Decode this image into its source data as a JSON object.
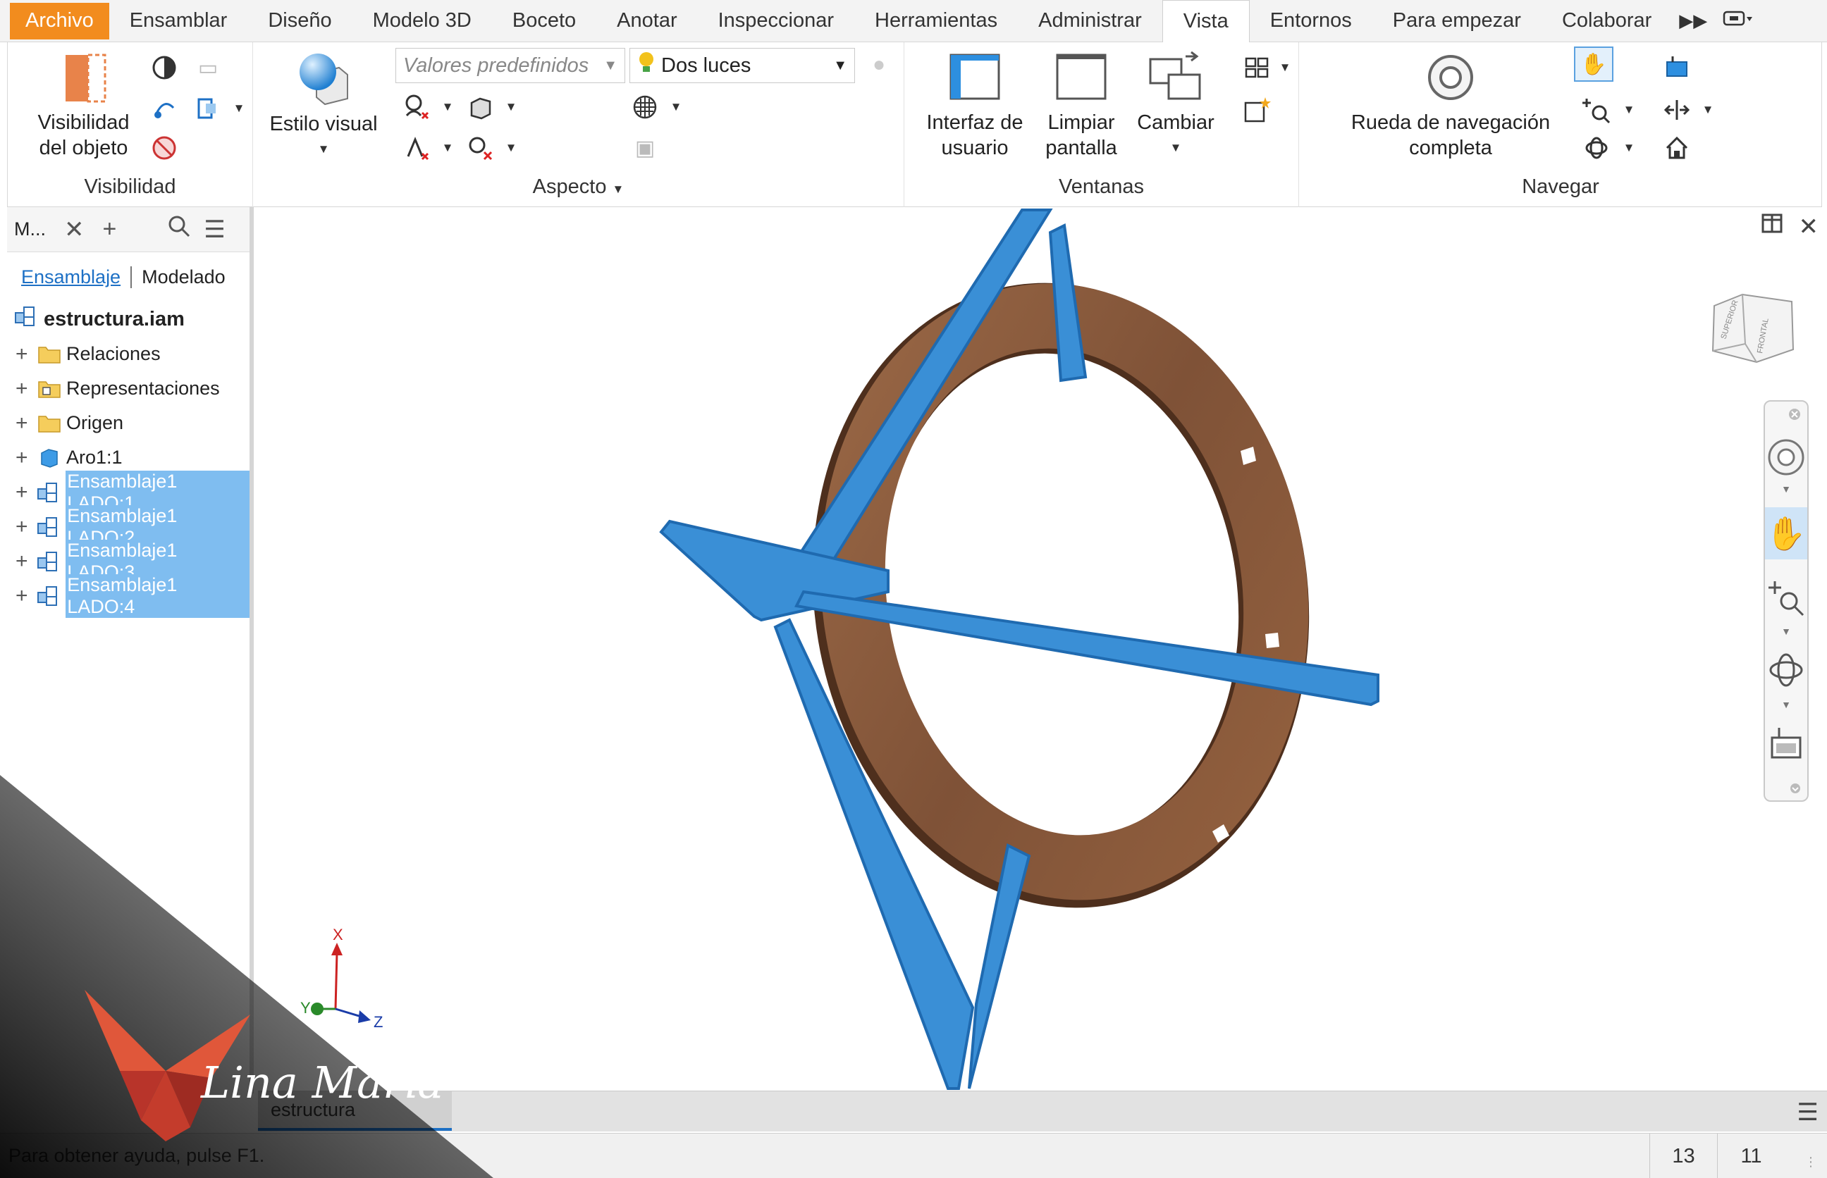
{
  "ribbon_tabs": [
    "Archivo",
    "Ensamblar",
    "Diseño",
    "Modelo 3D",
    "Boceto",
    "Anotar",
    "Inspeccionar",
    "Herramientas",
    "Administrar",
    "Vista",
    "Entornos",
    "Para empezar",
    "Colaborar"
  ],
  "active_tab": "Vista",
  "panels": {
    "visibilidad": {
      "title": "Visibilidad",
      "object_visibility_label": "Visibilidad del objeto"
    },
    "aspecto": {
      "title": "Aspecto",
      "visual_style_label": "Estilo visual",
      "presets_placeholder": "Valores predefinidos",
      "lighting_value": "Dos luces"
    },
    "ventanas": {
      "title": "Ventanas",
      "user_interface_label": "Interfaz de usuario",
      "clean_screen_label": "Limpiar pantalla",
      "switch_label": "Cambiar"
    },
    "navegar": {
      "title": "Navegar",
      "full_nav_wheel_label": "Rueda de navegación completa"
    }
  },
  "browser": {
    "title": "M...",
    "modes": [
      "Ensamblaje",
      "Modelado"
    ],
    "root": "estructura.iam",
    "items": [
      {
        "label": "Relaciones",
        "icon": "folder-icon",
        "selected": false
      },
      {
        "label": "Representaciones",
        "icon": "representations-folder-icon",
        "selected": false
      },
      {
        "label": "Origen",
        "icon": "folder-icon",
        "selected": false
      },
      {
        "label": "Aro1:1",
        "icon": "part-icon",
        "selected": false
      },
      {
        "label": "Ensamblaje1 LADO:1",
        "icon": "subassembly-icon",
        "selected": true
      },
      {
        "label": "Ensamblaje1 LADO:2",
        "icon": "subassembly-icon",
        "selected": true
      },
      {
        "label": "Ensamblaje1 LADO:3",
        "icon": "subassembly-icon",
        "selected": true
      },
      {
        "label": "Ensamblaje1 LADO:4",
        "icon": "subassembly-icon",
        "selected": true
      }
    ]
  },
  "viewcube": {
    "faces": [
      "SUPERIOR",
      "FRONTAL"
    ]
  },
  "triad": {
    "x": "X",
    "y": "Y",
    "z": "Z"
  },
  "doc_tab": "estructura",
  "status": {
    "help_text": "Para obtener ayuda, pulse F1.",
    "count_a": "13",
    "count_b": "11"
  },
  "watermark_text": "Lina María",
  "colors": {
    "file_tab": "#f28c1e",
    "selection_blue": "#3a8fd6",
    "wood": "#8b5a3c",
    "highlight": "#7fbdf0"
  }
}
